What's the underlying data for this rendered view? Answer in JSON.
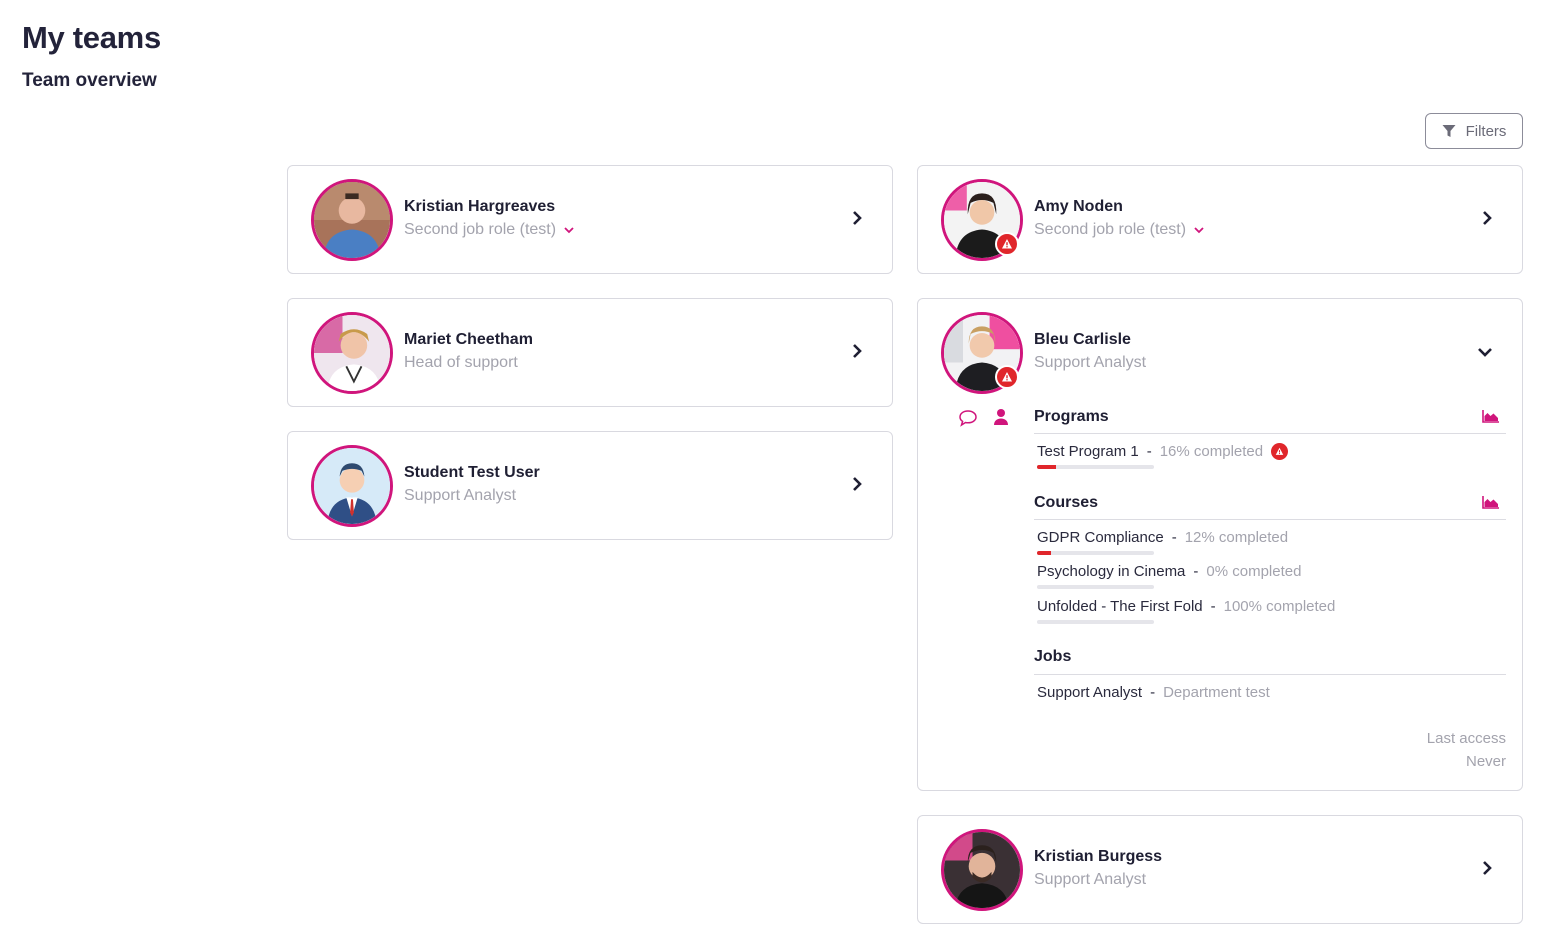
{
  "page": {
    "title": "My teams",
    "subtitle": "Team overview"
  },
  "filters": {
    "label": "Filters"
  },
  "members": [
    {
      "name": "Kristian Hargreaves",
      "role": "Second job role (test)",
      "has_role_dropdown": true,
      "alert": false
    },
    {
      "name": "Mariet Cheetham",
      "role": "Head of support",
      "has_role_dropdown": false,
      "alert": false
    },
    {
      "name": "Student Test User",
      "role": "Support Analyst",
      "has_role_dropdown": false,
      "alert": false
    },
    {
      "name": "Amy Noden",
      "role": "Second job role (test)",
      "has_role_dropdown": true,
      "alert": true
    },
    {
      "name": "Bleu Carlisle",
      "role": "Support Analyst",
      "alert": true,
      "expanded": true,
      "programs_title": "Programs",
      "programs": [
        {
          "name": "Test Program 1",
          "status": "16% completed",
          "progress": 0.16,
          "alert": true
        }
      ],
      "courses_title": "Courses",
      "courses": [
        {
          "name": "GDPR Compliance",
          "status": "12% completed",
          "progress": 0.12
        },
        {
          "name": "Psychology in Cinema",
          "status": "0% completed",
          "progress": 0
        },
        {
          "name": "Unfolded - The First Fold",
          "status": "100% completed",
          "progress": 1.0
        }
      ],
      "jobs_title": "Jobs",
      "jobs": [
        {
          "name": "Support Analyst",
          "department": "Department test"
        }
      ],
      "last_access_label": "Last access",
      "last_access_value": "Never"
    },
    {
      "name": "Kristian Burgess",
      "role": "Support Analyst",
      "has_role_dropdown": false,
      "alert": false
    }
  ],
  "colors": {
    "accent": "#d0157c",
    "alert": "#e0262b",
    "muted": "#a3a3ad",
    "text": "#1f1f33"
  },
  "icons": {
    "filter": "filter-funnel-icon",
    "chevron": "chevron-right-icon",
    "expand": "chevron-down-icon",
    "chart": "area-chart-icon",
    "message": "speech-bubble-icon",
    "profile": "user-icon",
    "alert": "warning-triangle-icon"
  }
}
